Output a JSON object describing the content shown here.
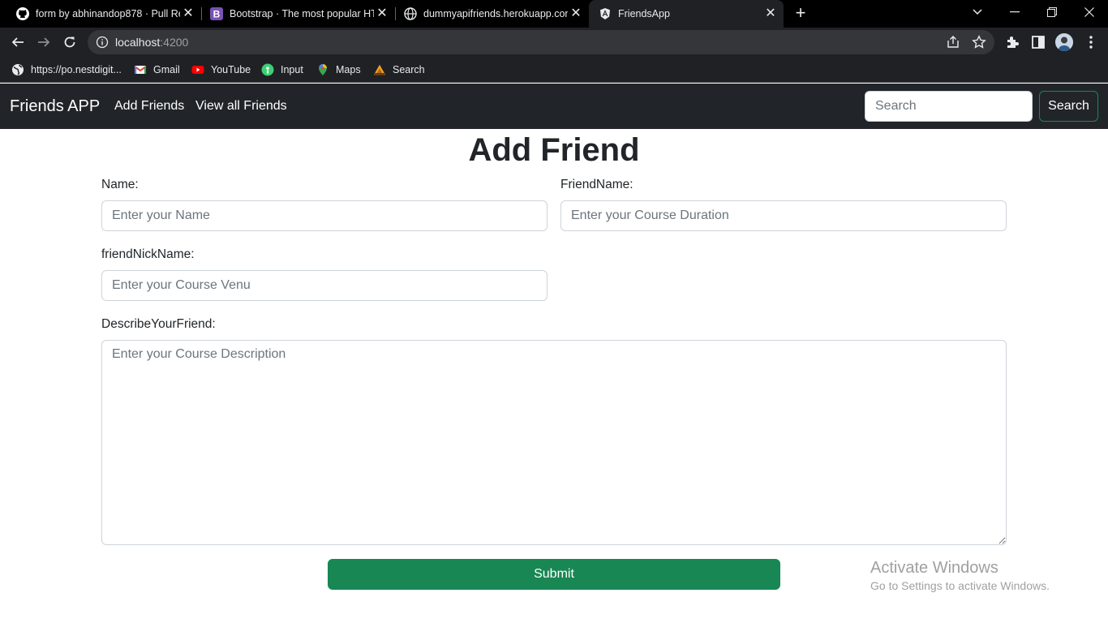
{
  "browser": {
    "tabs": [
      {
        "title": "form by abhinandop878 · Pull Re",
        "icon": "github-icon"
      },
      {
        "title": "Bootstrap · The most popular HTI",
        "icon": "bootstrap-icon"
      },
      {
        "title": "dummyapifriends.herokuapp.com",
        "icon": "globe-icon"
      },
      {
        "title": "FriendsApp",
        "icon": "angular-icon",
        "active": true
      }
    ],
    "address": {
      "host": "localhost",
      "port": ":4200"
    },
    "bookmarks": [
      {
        "label": "https://po.nestdigit...",
        "icon": "globe-icon"
      },
      {
        "label": "Gmail",
        "icon": "gmail-icon"
      },
      {
        "label": "YouTube",
        "icon": "youtube-icon"
      },
      {
        "label": "Input",
        "icon": "input-icon"
      },
      {
        "label": "Maps",
        "icon": "maps-icon"
      },
      {
        "label": "Search",
        "icon": "search-bookmark-icon"
      }
    ]
  },
  "navbar": {
    "brand": "Friends APP",
    "links": [
      "Add Friends",
      "View all Friends"
    ],
    "search_placeholder": "Search",
    "search_button": "Search",
    "accent": "#198754",
    "background": "#212529"
  },
  "form": {
    "title": "Add Friend",
    "name_label": "Name:",
    "name_placeholder": "Enter your Name",
    "friend_name_label": "FriendName:",
    "friend_name_placeholder": "Enter your Course Duration",
    "nickname_label": "friendNickName:",
    "nickname_placeholder": "Enter your Course Venu",
    "describe_label": "DescribeYourFriend:",
    "describe_placeholder": "Enter your Course Description",
    "submit_label": "Submit"
  },
  "watermark": {
    "title": "Activate Windows",
    "subtitle": "Go to Settings to activate Windows."
  }
}
